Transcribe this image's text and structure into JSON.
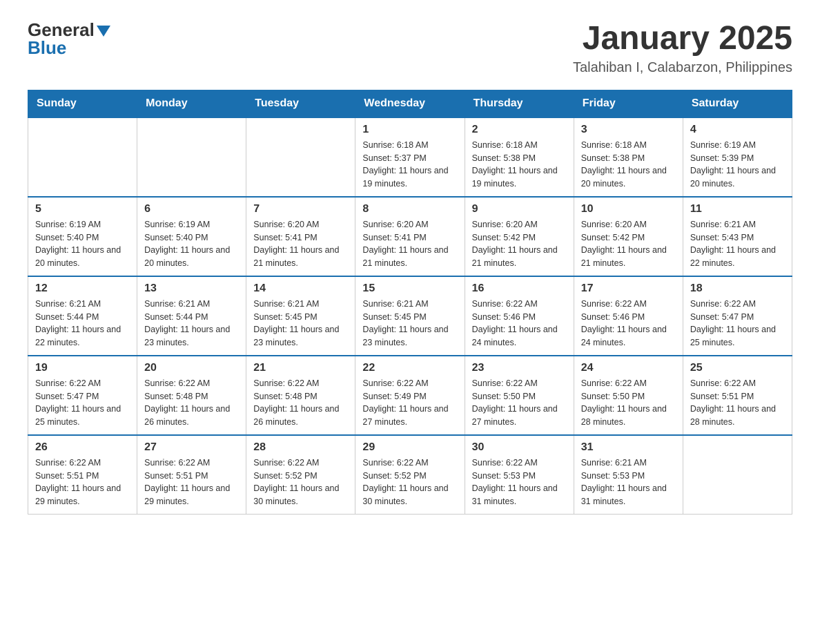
{
  "header": {
    "logo_general": "General",
    "logo_blue": "Blue",
    "month_title": "January 2025",
    "location": "Talahiban I, Calabarzon, Philippines"
  },
  "weekdays": [
    "Sunday",
    "Monday",
    "Tuesday",
    "Wednesday",
    "Thursday",
    "Friday",
    "Saturday"
  ],
  "weeks": [
    [
      {
        "day": "",
        "sunrise": "",
        "sunset": "",
        "daylight": ""
      },
      {
        "day": "",
        "sunrise": "",
        "sunset": "",
        "daylight": ""
      },
      {
        "day": "",
        "sunrise": "",
        "sunset": "",
        "daylight": ""
      },
      {
        "day": "1",
        "sunrise": "Sunrise: 6:18 AM",
        "sunset": "Sunset: 5:37 PM",
        "daylight": "Daylight: 11 hours and 19 minutes."
      },
      {
        "day": "2",
        "sunrise": "Sunrise: 6:18 AM",
        "sunset": "Sunset: 5:38 PM",
        "daylight": "Daylight: 11 hours and 19 minutes."
      },
      {
        "day": "3",
        "sunrise": "Sunrise: 6:18 AM",
        "sunset": "Sunset: 5:38 PM",
        "daylight": "Daylight: 11 hours and 20 minutes."
      },
      {
        "day": "4",
        "sunrise": "Sunrise: 6:19 AM",
        "sunset": "Sunset: 5:39 PM",
        "daylight": "Daylight: 11 hours and 20 minutes."
      }
    ],
    [
      {
        "day": "5",
        "sunrise": "Sunrise: 6:19 AM",
        "sunset": "Sunset: 5:40 PM",
        "daylight": "Daylight: 11 hours and 20 minutes."
      },
      {
        "day": "6",
        "sunrise": "Sunrise: 6:19 AM",
        "sunset": "Sunset: 5:40 PM",
        "daylight": "Daylight: 11 hours and 20 minutes."
      },
      {
        "day": "7",
        "sunrise": "Sunrise: 6:20 AM",
        "sunset": "Sunset: 5:41 PM",
        "daylight": "Daylight: 11 hours and 21 minutes."
      },
      {
        "day": "8",
        "sunrise": "Sunrise: 6:20 AM",
        "sunset": "Sunset: 5:41 PM",
        "daylight": "Daylight: 11 hours and 21 minutes."
      },
      {
        "day": "9",
        "sunrise": "Sunrise: 6:20 AM",
        "sunset": "Sunset: 5:42 PM",
        "daylight": "Daylight: 11 hours and 21 minutes."
      },
      {
        "day": "10",
        "sunrise": "Sunrise: 6:20 AM",
        "sunset": "Sunset: 5:42 PM",
        "daylight": "Daylight: 11 hours and 21 minutes."
      },
      {
        "day": "11",
        "sunrise": "Sunrise: 6:21 AM",
        "sunset": "Sunset: 5:43 PM",
        "daylight": "Daylight: 11 hours and 22 minutes."
      }
    ],
    [
      {
        "day": "12",
        "sunrise": "Sunrise: 6:21 AM",
        "sunset": "Sunset: 5:44 PM",
        "daylight": "Daylight: 11 hours and 22 minutes."
      },
      {
        "day": "13",
        "sunrise": "Sunrise: 6:21 AM",
        "sunset": "Sunset: 5:44 PM",
        "daylight": "Daylight: 11 hours and 23 minutes."
      },
      {
        "day": "14",
        "sunrise": "Sunrise: 6:21 AM",
        "sunset": "Sunset: 5:45 PM",
        "daylight": "Daylight: 11 hours and 23 minutes."
      },
      {
        "day": "15",
        "sunrise": "Sunrise: 6:21 AM",
        "sunset": "Sunset: 5:45 PM",
        "daylight": "Daylight: 11 hours and 23 minutes."
      },
      {
        "day": "16",
        "sunrise": "Sunrise: 6:22 AM",
        "sunset": "Sunset: 5:46 PM",
        "daylight": "Daylight: 11 hours and 24 minutes."
      },
      {
        "day": "17",
        "sunrise": "Sunrise: 6:22 AM",
        "sunset": "Sunset: 5:46 PM",
        "daylight": "Daylight: 11 hours and 24 minutes."
      },
      {
        "day": "18",
        "sunrise": "Sunrise: 6:22 AM",
        "sunset": "Sunset: 5:47 PM",
        "daylight": "Daylight: 11 hours and 25 minutes."
      }
    ],
    [
      {
        "day": "19",
        "sunrise": "Sunrise: 6:22 AM",
        "sunset": "Sunset: 5:47 PM",
        "daylight": "Daylight: 11 hours and 25 minutes."
      },
      {
        "day": "20",
        "sunrise": "Sunrise: 6:22 AM",
        "sunset": "Sunset: 5:48 PM",
        "daylight": "Daylight: 11 hours and 26 minutes."
      },
      {
        "day": "21",
        "sunrise": "Sunrise: 6:22 AM",
        "sunset": "Sunset: 5:48 PM",
        "daylight": "Daylight: 11 hours and 26 minutes."
      },
      {
        "day": "22",
        "sunrise": "Sunrise: 6:22 AM",
        "sunset": "Sunset: 5:49 PM",
        "daylight": "Daylight: 11 hours and 27 minutes."
      },
      {
        "day": "23",
        "sunrise": "Sunrise: 6:22 AM",
        "sunset": "Sunset: 5:50 PM",
        "daylight": "Daylight: 11 hours and 27 minutes."
      },
      {
        "day": "24",
        "sunrise": "Sunrise: 6:22 AM",
        "sunset": "Sunset: 5:50 PM",
        "daylight": "Daylight: 11 hours and 28 minutes."
      },
      {
        "day": "25",
        "sunrise": "Sunrise: 6:22 AM",
        "sunset": "Sunset: 5:51 PM",
        "daylight": "Daylight: 11 hours and 28 minutes."
      }
    ],
    [
      {
        "day": "26",
        "sunrise": "Sunrise: 6:22 AM",
        "sunset": "Sunset: 5:51 PM",
        "daylight": "Daylight: 11 hours and 29 minutes."
      },
      {
        "day": "27",
        "sunrise": "Sunrise: 6:22 AM",
        "sunset": "Sunset: 5:51 PM",
        "daylight": "Daylight: 11 hours and 29 minutes."
      },
      {
        "day": "28",
        "sunrise": "Sunrise: 6:22 AM",
        "sunset": "Sunset: 5:52 PM",
        "daylight": "Daylight: 11 hours and 30 minutes."
      },
      {
        "day": "29",
        "sunrise": "Sunrise: 6:22 AM",
        "sunset": "Sunset: 5:52 PM",
        "daylight": "Daylight: 11 hours and 30 minutes."
      },
      {
        "day": "30",
        "sunrise": "Sunrise: 6:22 AM",
        "sunset": "Sunset: 5:53 PM",
        "daylight": "Daylight: 11 hours and 31 minutes."
      },
      {
        "day": "31",
        "sunrise": "Sunrise: 6:21 AM",
        "sunset": "Sunset: 5:53 PM",
        "daylight": "Daylight: 11 hours and 31 minutes."
      },
      {
        "day": "",
        "sunrise": "",
        "sunset": "",
        "daylight": ""
      }
    ]
  ]
}
